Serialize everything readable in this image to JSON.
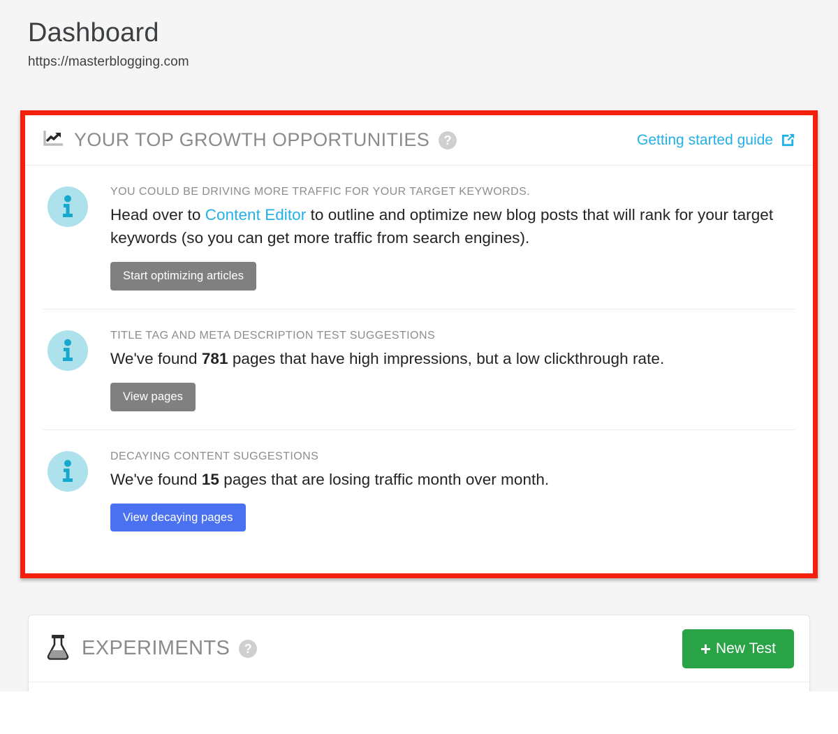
{
  "header": {
    "title": "Dashboard",
    "site_url": "https://masterblogging.com"
  },
  "growth_card": {
    "icon": "line-chart-up-icon",
    "title": "YOUR TOP GROWTH OPPORTUNITIES",
    "help_badge": "?",
    "guide_link_label": "Getting started guide",
    "guide_link_icon": "external-link-icon",
    "accent_color": "#22b0e8",
    "highlight_border_color": "#f4200c",
    "opportunities": [
      {
        "icon": "info-icon",
        "kicker": "YOU COULD BE DRIVING MORE TRAFFIC FOR YOUR TARGET KEYWORDS.",
        "text_before_link": "Head over to ",
        "link_text": "Content Editor",
        "text_after_link": " to outline and optimize new blog posts that will rank for your target keywords (so you can get more traffic from search engines).",
        "button_label": "Start optimizing articles",
        "button_color": "#808080"
      },
      {
        "icon": "info-icon",
        "kicker": "TITLE TAG AND META DESCRIPTION TEST SUGGESTIONS",
        "text_before_value": "We've found ",
        "value": "781",
        "text_after_value": " pages that have high impressions, but a low clickthrough rate.",
        "button_label": "View pages",
        "button_color": "#808080"
      },
      {
        "icon": "info-icon",
        "kicker": "DECAYING CONTENT SUGGESTIONS",
        "text_before_value": "We've found ",
        "value": "15",
        "text_after_value": " pages that are losing traffic month over month.",
        "button_label": "View decaying pages",
        "button_color": "#4a72f0"
      }
    ]
  },
  "experiments_card": {
    "icon": "flask-icon",
    "title": "EXPERIMENTS",
    "help_badge": "?",
    "new_test_label": "New Test",
    "new_test_plus": "+",
    "new_test_color": "#29a345"
  }
}
